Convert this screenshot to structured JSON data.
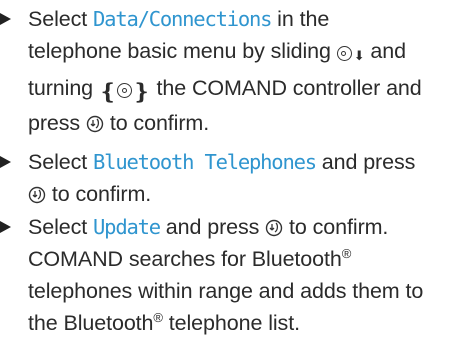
{
  "steps": [
    {
      "before": "Select ",
      "highlight": "Data/Connections",
      "line1_after": " in the",
      "line2": "telephone basic menu by sliding ",
      "line3_a": "turning ",
      "line3_b": " the COMAND controller and",
      "line4_a": "press ",
      "line4_b": " to confirm."
    },
    {
      "before": "Select ",
      "highlight": "Bluetooth Telephones",
      "after": " and press",
      "line2_b": " to confirm."
    },
    {
      "before": "Select ",
      "highlight": "Update",
      "after_a": " and press ",
      "after_b": " to confirm.",
      "line2": "COMAND searches for Bluetooth",
      "reg1": "®",
      "line3": "telephones within range and adds them to",
      "line4_a": "the Bluetooth",
      "reg2": "®",
      "line4_b": " telephone list."
    }
  ],
  "controller_icons": {
    "slide": "slide-down-icon",
    "turn": "turn-controller-icon",
    "press": "press-controller-icon"
  },
  "colors": {
    "text": "#2b2b2b",
    "highlight": "#2f95cf"
  },
  "and_word": "and"
}
